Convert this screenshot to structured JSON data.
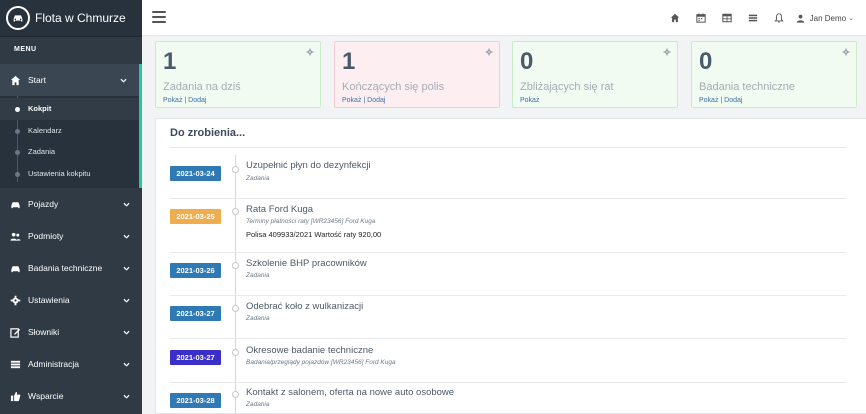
{
  "brand": {
    "name": "Flota w Chmurze"
  },
  "sidebar": {
    "menu_label": "MENU",
    "items": [
      {
        "label": "Start",
        "icon": "home-icon"
      },
      {
        "label": "Pojazdy",
        "icon": "car-icon"
      },
      {
        "label": "Podmioty",
        "icon": "users-icon"
      },
      {
        "label": "Badania techniczne",
        "icon": "car-icon"
      },
      {
        "label": "Ustawienia",
        "icon": "gear-icon"
      },
      {
        "label": "Słowniki",
        "icon": "edit-icon"
      },
      {
        "label": "Administracja",
        "icon": "list-icon"
      },
      {
        "label": "Wsparcie",
        "icon": "thumbs-up-icon"
      }
    ],
    "subitems": [
      "Kokpit",
      "Kalendarz",
      "Zadania",
      "Ustawienia kokpitu"
    ],
    "accent": "#2bc3a0"
  },
  "topbar": {
    "icons": [
      "home-icon",
      "calendar-icon",
      "table-icon",
      "list-icon",
      "bell-icon"
    ],
    "user": "Jan Demo",
    "caret": "⌄"
  },
  "cards": [
    {
      "count": "1",
      "title": "Zadania na dziś",
      "links": "Pokaż | Dodaj",
      "tone": "green"
    },
    {
      "count": "1",
      "title": "Kończących się polis",
      "links": "Pokaż | Dodaj",
      "tone": "pink"
    },
    {
      "count": "0",
      "title": "Zbliżających się rat",
      "links": "Pokaż",
      "tone": "green"
    },
    {
      "count": "0",
      "title": "Badania techniczne",
      "links": "Pokaż | Dodaj",
      "tone": "green"
    }
  ],
  "todo": {
    "title": "Do zrobienia...",
    "items": [
      {
        "date": "2021-03-24",
        "color": "#2f79b5",
        "title": "Uzupełnić płyn do dezynfekcji",
        "sub": "Zadania",
        "extra": ""
      },
      {
        "date": "2021-03-25",
        "color": "#f0ad4e",
        "title": "Rata Ford Kuga",
        "sub": "Terminy płatności raty [WR23456] Ford Kuga",
        "extra": "Polisa 409933/2021 Wartość raty 920,00"
      },
      {
        "date": "2021-03-26",
        "color": "#2f79b5",
        "title": "Szkolenie BHP pracowników",
        "sub": "Zadania",
        "extra": ""
      },
      {
        "date": "2021-03-27",
        "color": "#2f79b5",
        "title": "Odebrać koło z wulkanizacji",
        "sub": "Zadania",
        "extra": ""
      },
      {
        "date": "2021-03-27",
        "color": "#3a2fc8",
        "title": "Okresowe badanie techniczne",
        "sub": "Badania/przeglądy pojazdów [WR23456] Ford Kuga",
        "extra": ""
      },
      {
        "date": "2021-03-28",
        "color": "#2f79b5",
        "title": "Kontakt z salonem, oferta na nowe auto osobowe",
        "sub": "Zadania",
        "extra": ""
      }
    ]
  }
}
